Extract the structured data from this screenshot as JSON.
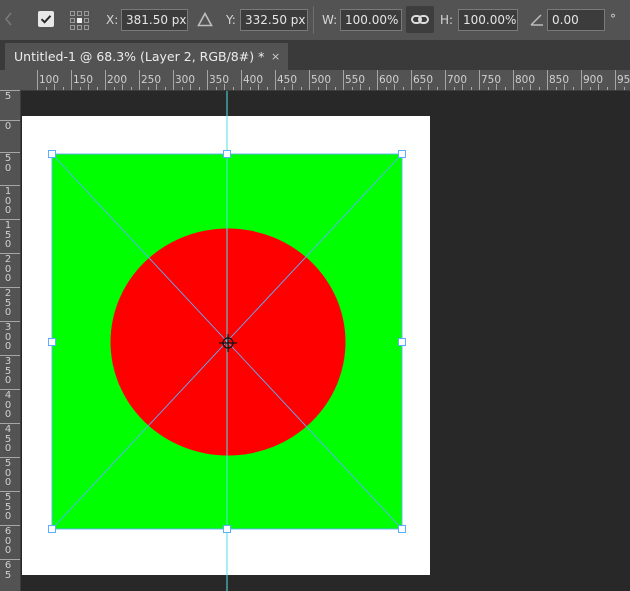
{
  "options_bar": {
    "x_label": "X:",
    "x_value": "381.50 px",
    "y_label": "Y:",
    "y_value": "332.50 px",
    "w_label": "W:",
    "w_value": "100.00%",
    "h_label": "H:",
    "h_value": "100.00%",
    "angle_value": "0.00",
    "angle_unit": "°",
    "commit_checked": true,
    "link_active": true
  },
  "document_tab": {
    "title": "Untitled-1 @ 68.3% (Layer 2, RGB/8#) *",
    "close_symbol": "×"
  },
  "ruler_top": [
    "100",
    "150",
    "200",
    "250",
    "300",
    "350",
    "400",
    "450",
    "500",
    "550",
    "600",
    "650",
    "700",
    "750",
    "800",
    "850",
    "900",
    "95"
  ],
  "ruler_left": [
    "5",
    "0",
    "5 0",
    "1 0 0",
    "1 5 0",
    "2 0 0",
    "2 5 0",
    "3 0 0",
    "3 5 0",
    "4 0 0",
    "4 5 0",
    "5 0 0",
    "5 5 0",
    "6 0 0",
    "6 5"
  ],
  "colors": {
    "layer_fill": "#00ff00",
    "shape_fill": "#ff0000",
    "document": "#ffffff",
    "guide": "#4ee0e8",
    "transform_box": "#5ab0ff"
  },
  "icons": {
    "commit": "checkmark-icon",
    "reference_point": "reference-point-grid-icon",
    "delta": "triangle-delta-icon",
    "link": "chain-link-icon",
    "angle": "angle-icon",
    "pivot": "crosshair-pivot-icon"
  }
}
